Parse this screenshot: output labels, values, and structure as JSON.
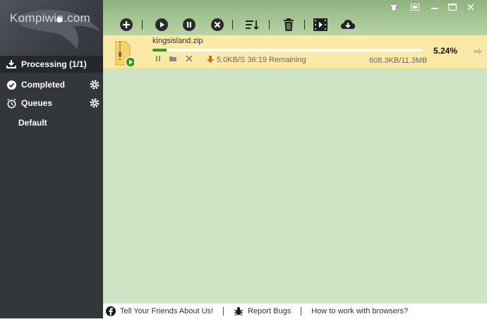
{
  "watermark": "Kompiwin.com",
  "sidebar": {
    "items": [
      {
        "label": "Processing (1/1)",
        "icon": "download-icon"
      },
      {
        "label": "Completed",
        "icon": "check-circle-icon",
        "has_settings": true
      },
      {
        "label": "Queues",
        "icon": "alarm-clock-icon",
        "has_settings": true
      },
      {
        "label": "Default"
      }
    ]
  },
  "toolbar": {
    "buttons": [
      "add-icon",
      "play-icon",
      "pause-icon",
      "stop-icon",
      "sort-icon",
      "trash-icon",
      "video-icon",
      "cloud-download-icon"
    ]
  },
  "download": {
    "filename": "kingsisland.zip",
    "progress": 0.0524,
    "percent_text": "5.24%",
    "speed_text": "5.0KB/S 36:19 Remaining",
    "size_text": "608.3KB/11.3MB"
  },
  "status_bar": {
    "share": "Tell Your Friends About Us!",
    "bugs": "Report Bugs",
    "help": "How to work with browsers?"
  },
  "colors": {
    "accent_green": "#2e9b22",
    "row_highlight": "#fbe9a8",
    "sidebar": "#33363b",
    "content": "#cfe3c5"
  }
}
